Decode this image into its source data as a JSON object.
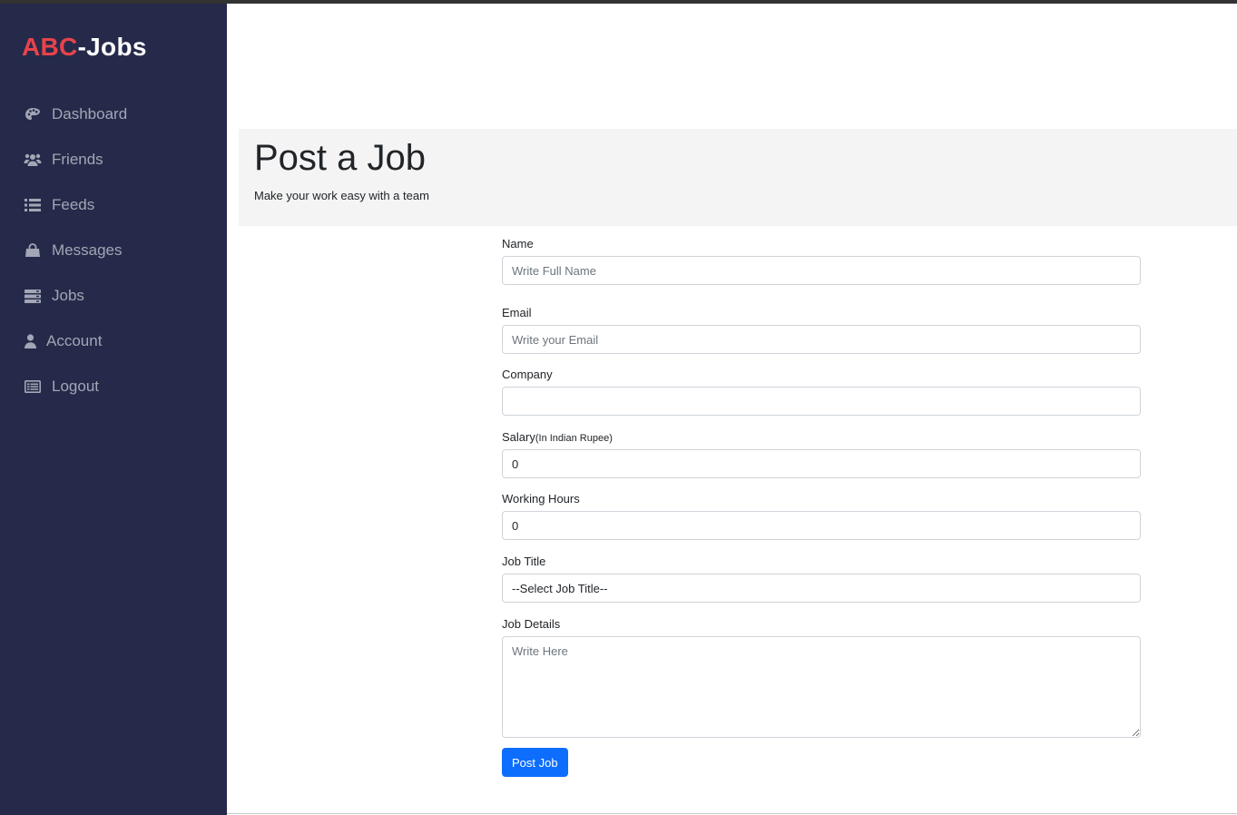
{
  "brand": {
    "part1": "ABC",
    "part2": "-Jobs"
  },
  "sidebar": {
    "items": [
      {
        "label": "Dashboard",
        "icon": "palette-icon"
      },
      {
        "label": "Friends",
        "icon": "users-icon"
      },
      {
        "label": "Feeds",
        "icon": "list-icon"
      },
      {
        "label": "Messages",
        "icon": "shopping-bag-icon"
      },
      {
        "label": "Jobs",
        "icon": "server-icon"
      },
      {
        "label": "Account",
        "icon": "user-icon"
      },
      {
        "label": "Logout",
        "icon": "id-card-icon"
      }
    ]
  },
  "hero": {
    "title": "Post a Job",
    "subtitle": "Make your work easy with a team"
  },
  "form": {
    "name": {
      "label": "Name",
      "placeholder": "Write Full Name"
    },
    "email": {
      "label": "Email",
      "placeholder": "Write your Email"
    },
    "company": {
      "label": "Company",
      "value": ""
    },
    "salary": {
      "label": "Salary",
      "label_suffix": "(In Indian Rupee)",
      "value": "0"
    },
    "hours": {
      "label": "Working Hours",
      "value": "0"
    },
    "job_title": {
      "label": "Job Title",
      "selected": "--Select Job Title--"
    },
    "details": {
      "label": "Job Details",
      "placeholder": "Write Here"
    },
    "submit_label": "Post Job"
  },
  "colors": {
    "sidebar_bg": "#252a4a",
    "brand_red": "#e8434b",
    "primary": "#0d6efd",
    "hero_bg": "#f4f4f4"
  }
}
